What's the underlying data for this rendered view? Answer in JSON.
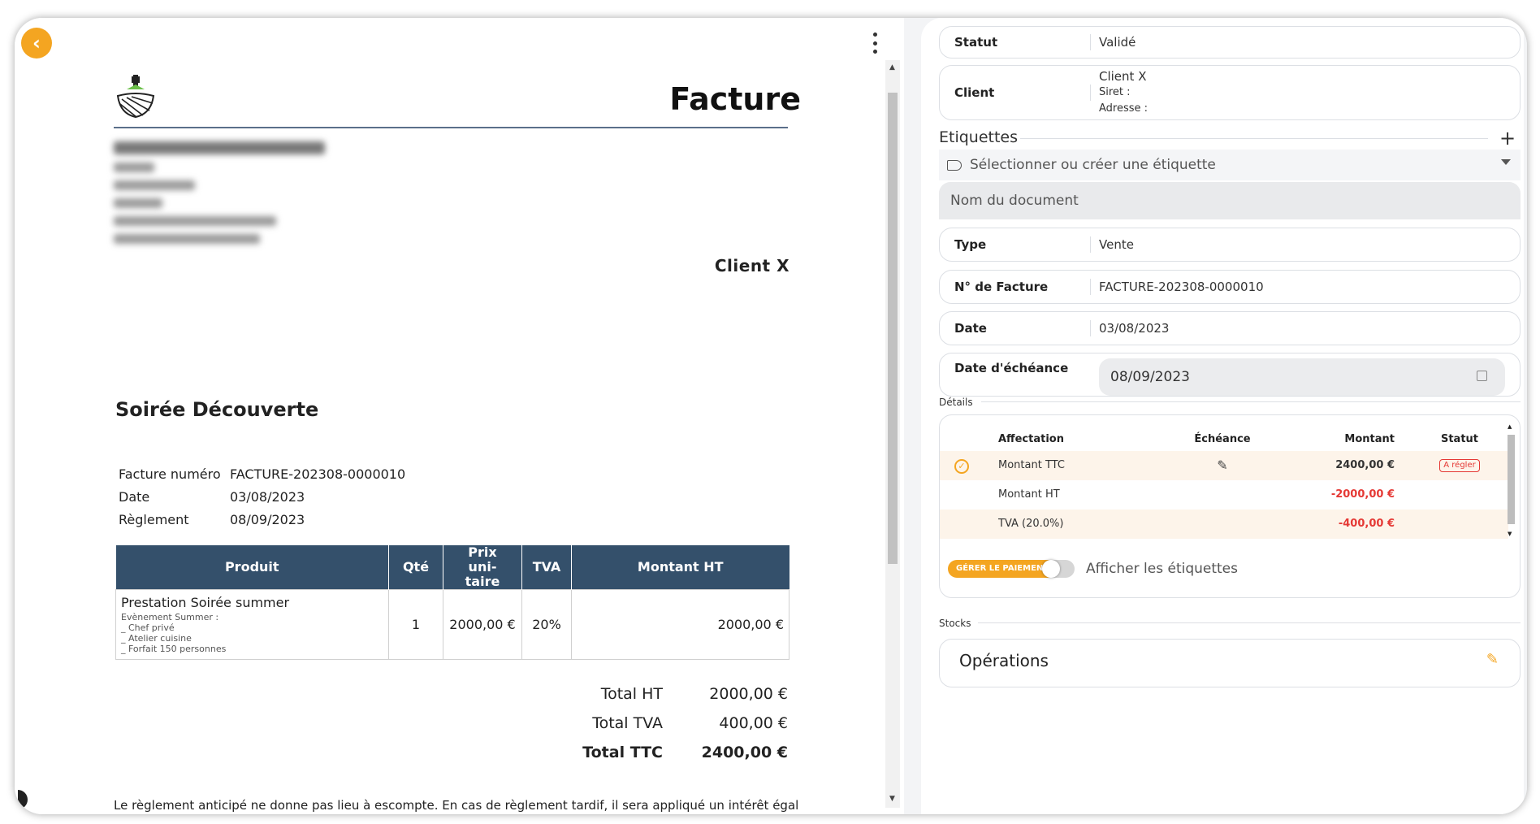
{
  "doc": {
    "title": "Facture",
    "client": "Client X",
    "subject": "Soirée Découverte",
    "meta": [
      {
        "label": "Facture numéro",
        "value": "FACTURE-202308-0000010"
      },
      {
        "label": "Date",
        "value": "03/08/2023"
      },
      {
        "label": "Règlement",
        "value": "08/09/2023"
      }
    ],
    "table": {
      "headers": [
        "Produit",
        "Qté",
        "Prix uni-taire",
        "TVA",
        "Montant HT"
      ],
      "rows": [
        {
          "product": "Prestation Soirée summer",
          "desc": [
            "Evènement Summer :",
            "_ Chef privé",
            "_ Atelier cuisine",
            "_ Forfait 150 personnes"
          ],
          "qty": "1",
          "unit_price": "2000,00 €",
          "tva": "20%",
          "amount": "2000,00 €"
        }
      ]
    },
    "totals": [
      {
        "label": "Total HT",
        "value": "2000,00 €"
      },
      {
        "label": "Total TVA",
        "value": "400,00 €"
      },
      {
        "label": "Total TTC",
        "value": "2400,00 €"
      }
    ],
    "footnote": "Le règlement anticipé ne donne pas lieu à escompte. En cas de règlement tardif, il sera appliqué un intérêt égal"
  },
  "panel": {
    "statut": {
      "label": "Statut",
      "value": "Validé"
    },
    "client": {
      "label": "Client",
      "name": "Client X",
      "siret": "Siret :",
      "adresse": "Adresse :"
    },
    "etiquettes": {
      "label": "Etiquettes",
      "placeholder": "Sélectionner ou créer une étiquette"
    },
    "doc_name_placeholder": "Nom du document",
    "type": {
      "label": "Type",
      "value": "Vente"
    },
    "numero": {
      "label": "N° de Facture",
      "value": "FACTURE-202308-0000010"
    },
    "date": {
      "label": "Date",
      "value": "03/08/2023"
    },
    "echeance": {
      "label": "Date d'échéance",
      "value": "08/09/2023"
    },
    "details_label": "Détails",
    "details": {
      "headers": {
        "affectation": "Affectation",
        "echeance": "Échéance",
        "montant": "Montant",
        "statut": "Statut"
      },
      "rows": [
        {
          "affectation": "Montant TTC",
          "montant": "2400,00 €",
          "statut": "A régler"
        },
        {
          "affectation": "Montant HT",
          "montant": "-2000,00 €"
        },
        {
          "affectation": "TVA (20.0%)",
          "montant": "-400,00 €"
        }
      ],
      "pay_button": "GÉRER LE PAIEMENT",
      "toggle_label": "Afficher les étiquettes"
    },
    "stocks_label": "Stocks",
    "operations_label": "Opérations"
  },
  "colors": {
    "accent": "#f4a521",
    "table_header": "#34506b",
    "negative": "#e53935"
  }
}
